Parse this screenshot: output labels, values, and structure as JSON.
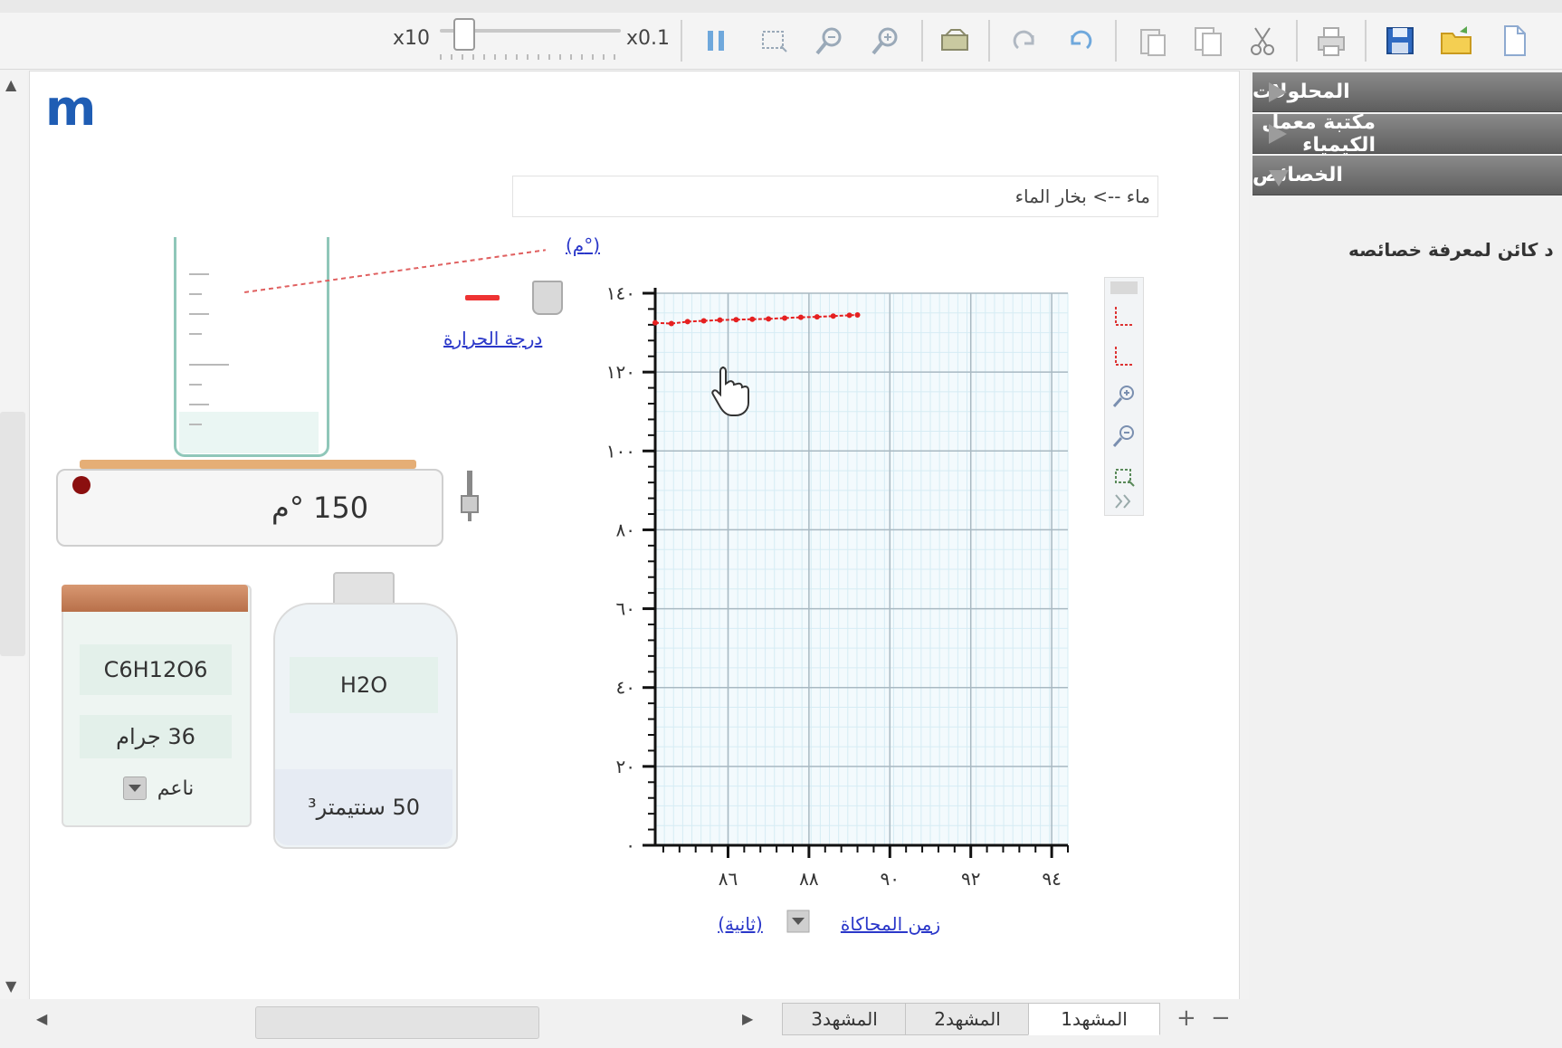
{
  "toolbar": {
    "speed_min_label": "x10",
    "speed_max_label": "x0.1",
    "icons": [
      "pause-icon",
      "select-rect-icon",
      "zoom-out-icon",
      "zoom-in-icon",
      "screenshot-icon",
      "redo-icon",
      "undo-icon",
      "paste-icon",
      "copy-icon",
      "cut-icon",
      "print-icon",
      "save-icon",
      "open-folder-icon",
      "new-document-icon"
    ]
  },
  "side_panel": {
    "items": [
      {
        "label": "المحلولات",
        "state": "collapsed"
      },
      {
        "label": "مكتبة معمل الكيمياء",
        "state": "collapsed"
      },
      {
        "label": "الخصائص",
        "state": "expanded"
      }
    ],
    "description": "د كائن لمعرفة خصائصه"
  },
  "simulation": {
    "logo": "m",
    "title": "ماء --> بخار الماء",
    "hot_plate": {
      "temperature": "150 °م"
    },
    "probe_label": "درجة الحرارة",
    "solid_jar": {
      "formula": "C6H12O6",
      "amount": "36 جرام",
      "form": "ناعم"
    },
    "water_bottle": {
      "formula": "H2O",
      "volume": "50 سنتيمتر³"
    }
  },
  "chart_data": {
    "type": "line",
    "ylabel": "(م°)",
    "xlabel": "زمن المحاكاة",
    "x_unit": "(ثانية)",
    "y_ticks": [
      "٠",
      "٢٠",
      "٤٠",
      "٦٠",
      "٨٠",
      "١٠٠",
      "١٢٠",
      "١٤٠"
    ],
    "x_ticks": [
      "٨٦",
      "٨٨",
      "٩٠",
      "٩٢",
      "٩٤"
    ],
    "xlim": [
      84.2,
      94.4
    ],
    "ylim": [
      0,
      140
    ],
    "grid": true,
    "series": [
      {
        "color": "#e52020",
        "x": [
          84.2,
          84.6,
          85.0,
          85.4,
          85.8,
          86.2,
          86.6,
          87.0,
          87.4,
          87.8,
          88.2,
          88.6,
          89.0,
          89.2
        ],
        "y": [
          132.5,
          132.3,
          132.8,
          133.0,
          133.2,
          133.3,
          133.4,
          133.5,
          133.7,
          133.9,
          134.0,
          134.2,
          134.4,
          134.5
        ]
      }
    ]
  },
  "scenes": {
    "tabs": [
      "المشهد1",
      "المشهد2",
      "المشهد3"
    ],
    "active": 0,
    "add_label": "+",
    "remove_label": "−"
  }
}
